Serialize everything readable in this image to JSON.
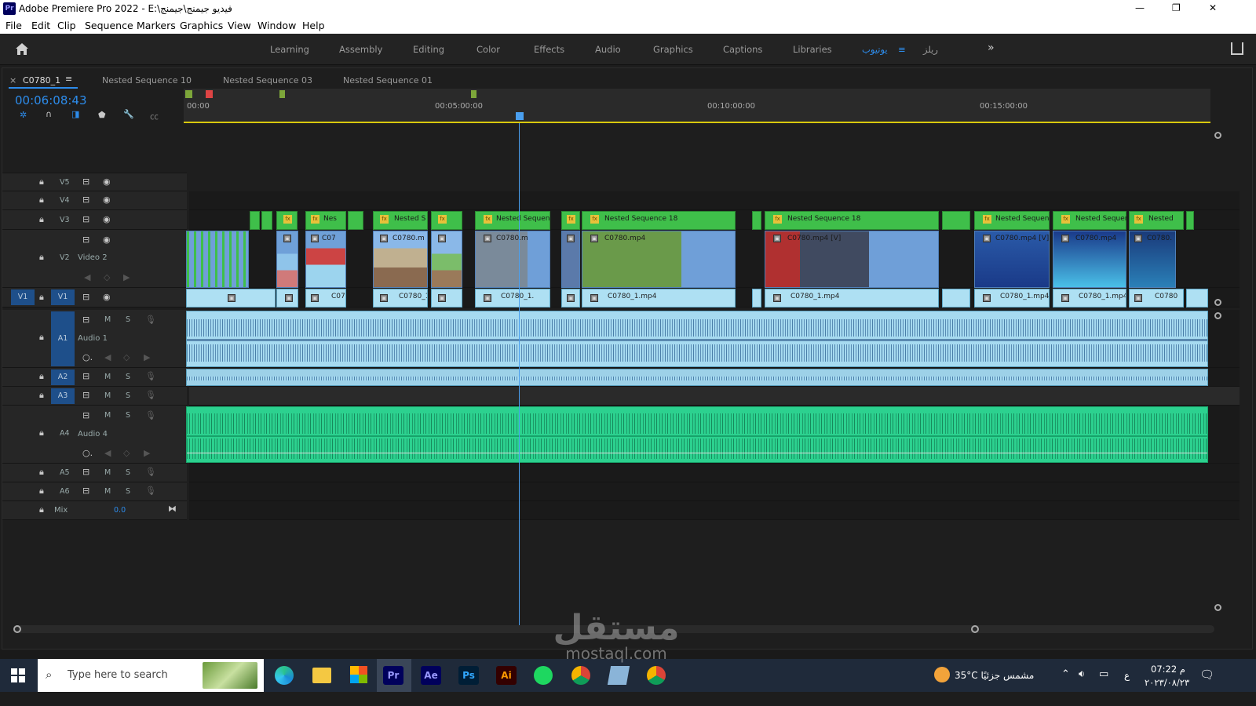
{
  "titlebar": {
    "app_title": "Adobe Premiere Pro 2022 - E:\\فيديو جيمنج\\جيمنج",
    "min": "—",
    "max": "❐",
    "close": "✕"
  },
  "menu": [
    "File",
    "Edit",
    "Clip",
    "Sequence",
    "Markers",
    "Graphics",
    "View",
    "Window",
    "Help"
  ],
  "workspaces": [
    "Learning",
    "Assembly",
    "Editing",
    "Color",
    "Effects",
    "Audio",
    "Graphics",
    "Captions",
    "Libraries",
    "يوتيوب",
    "ريلز"
  ],
  "sequence_tabs": {
    "active": "C0780_1",
    "others": [
      "Nested Sequence 10",
      "Nested Sequence 03",
      "Nested Sequence 01"
    ]
  },
  "timecode": "00:06:08:43",
  "ruler": [
    "00:00",
    "00:05:00:00",
    "00:10:00:00",
    "00:15:00:00"
  ],
  "tracks": {
    "video": [
      {
        "id": "V5",
        "name": ""
      },
      {
        "id": "V4",
        "name": ""
      },
      {
        "id": "V3",
        "name": ""
      },
      {
        "id": "V2",
        "name": "Video 2"
      },
      {
        "id": "V1",
        "name": "",
        "source": "V1"
      }
    ],
    "audio": [
      {
        "id": "A1",
        "name": "Audio 1"
      },
      {
        "id": "A2",
        "name": ""
      },
      {
        "id": "A3",
        "name": ""
      },
      {
        "id": "A4",
        "name": "Audio 4"
      },
      {
        "id": "A5",
        "name": ""
      },
      {
        "id": "A6",
        "name": ""
      }
    ],
    "mix": {
      "label": "Mix",
      "value": "0.0"
    },
    "mute_label": "M",
    "solo_label": "S"
  },
  "v3_clips": [
    "Nes",
    "Nested S",
    "Nested Sequen",
    "Nested Sequence 18",
    "Nested Sequence 18",
    "Nested Sequence",
    "Nested Sequen",
    "Nested"
  ],
  "v2_clips": [
    "C07",
    "C0780.m",
    "C0780.m",
    "C0780.mp4",
    "C0780.mp4 [V]",
    "C0780.mp4 [V]",
    "C0780.mp4",
    "C0780."
  ],
  "v1_clips": [
    "C07",
    "C0780_1.",
    "C0780_1.",
    "C0780_1.mp4",
    "C0780_1.mp4",
    "C0780_1.mp4",
    "C0780_1.mp4",
    "C0780"
  ],
  "taskbar": {
    "search_placeholder": "Type here to search",
    "apps": [
      "Pr",
      "Ae",
      "Ps",
      "Ai"
    ],
    "weather": "35°C  مشمس جزئيًا",
    "time": "07:22 م",
    "date": "٢٠٢٣/٠٨/٢٣",
    "lang": "ع"
  },
  "watermark": {
    "brand": "مستقل",
    "site": "mostaql.com"
  },
  "colors": {
    "accent": "#2d8ceb",
    "green_clip": "#3fbf4a",
    "audio_clip": "#a6daf0",
    "audio4_clip": "#2cd18f",
    "playhead": "#4a9fef"
  }
}
